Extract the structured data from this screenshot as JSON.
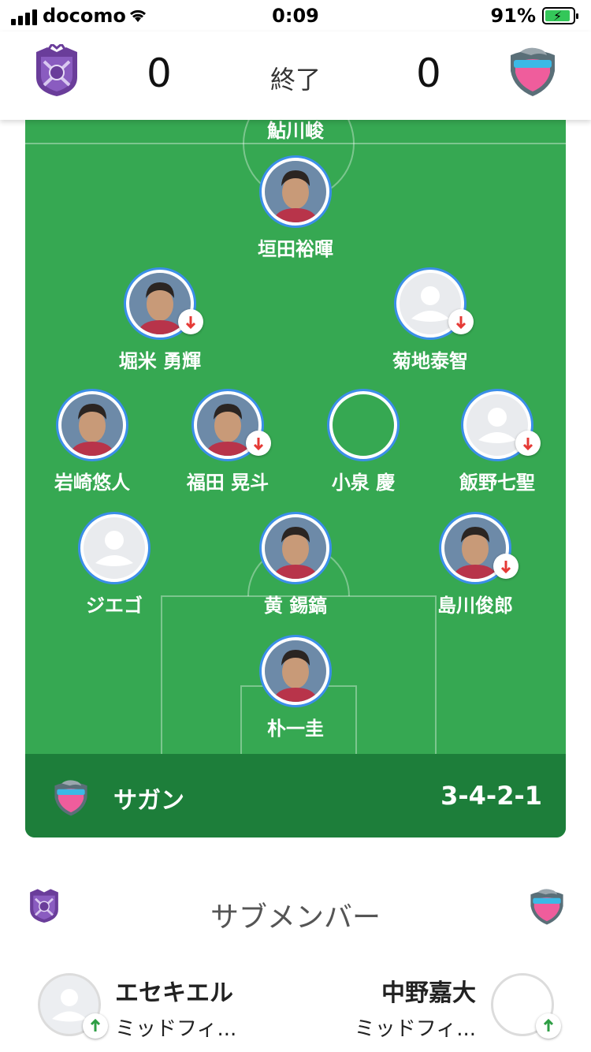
{
  "status_bar": {
    "carrier": "docomo",
    "time": "0:09",
    "battery": "91%",
    "battery_level": 0.91
  },
  "match": {
    "home_score": "0",
    "away_score": "0",
    "status": "終了"
  },
  "lineup": {
    "top_cut_name": "鮎川峻",
    "team_name": "サガン",
    "formation": "3-4-2-1",
    "players": [
      {
        "name": "垣田裕暉",
        "photo": true,
        "sub_out": false
      },
      {
        "name": "堀米 勇輝",
        "photo": true,
        "sub_out": true
      },
      {
        "name": "菊地泰智",
        "photo": false,
        "sub_out": true
      },
      {
        "name": "岩崎悠人",
        "photo": true,
        "sub_out": false
      },
      {
        "name": "福田 晃斗",
        "photo": true,
        "sub_out": true
      },
      {
        "name": "小泉 慶",
        "photo": false,
        "sub_out": false
      },
      {
        "name": "飯野七聖",
        "photo": false,
        "sub_out": true
      },
      {
        "name": "ジエゴ",
        "photo": false,
        "sub_out": false
      },
      {
        "name": "黄 錫鎬",
        "photo": true,
        "sub_out": false
      },
      {
        "name": "島川俊郎",
        "photo": true,
        "sub_out": true
      },
      {
        "name": "朴一圭",
        "photo": true,
        "sub_out": false
      }
    ]
  },
  "subs": {
    "title": "サブメンバー",
    "home": {
      "name": "エセキエル",
      "position": "ミッドフィ..."
    },
    "away": {
      "name": "中野嘉大",
      "position": "ミッドフィ..."
    }
  },
  "colors": {
    "pitch": "#36a852",
    "team_bar": "#1d7e3a",
    "avatar_ring": "#3b8ee8",
    "sub_out_arrow": "#e53935",
    "sub_in_arrow": "#2e9e44",
    "home_club": "#6a3d9a",
    "away_club_pink": "#ef5d9c"
  },
  "icons": {
    "sub_out": "arrow-down-icon",
    "sub_in": "arrow-up-icon",
    "home_logo": "sanfrecce-crest-icon",
    "away_logo": "sagan-crest-icon"
  }
}
